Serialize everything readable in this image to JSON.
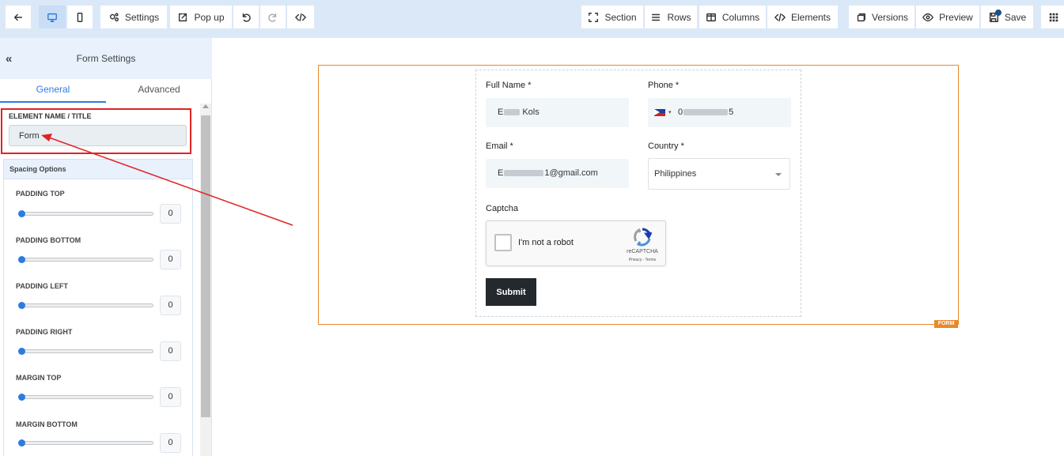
{
  "toolbar": {
    "settings_label": "Settings",
    "popup_label": "Pop up",
    "section_label": "Section",
    "rows_label": "Rows",
    "columns_label": "Columns",
    "elements_label": "Elements",
    "versions_label": "Versions",
    "preview_label": "Preview",
    "save_label": "Save"
  },
  "sidebar": {
    "title": "Form Settings",
    "tabs": [
      {
        "label": "General",
        "active": true
      },
      {
        "label": "Advanced",
        "active": false
      }
    ],
    "element_name_label": "ELEMENT NAME / TITLE",
    "element_name_value": "Form",
    "spacing_header": "Spacing Options",
    "spacing": [
      {
        "label": "PADDING TOP",
        "value": "0"
      },
      {
        "label": "PADDING BOTTOM",
        "value": "0"
      },
      {
        "label": "PADDING LEFT",
        "value": "0"
      },
      {
        "label": "PADDING RIGHT",
        "value": "0"
      },
      {
        "label": "MARGIN TOP",
        "value": "0"
      },
      {
        "label": "MARGIN BOTTOM",
        "value": "0"
      }
    ]
  },
  "canvas": {
    "form_tag": "FORM",
    "form": {
      "full_name_label": "Full Name *",
      "full_name_prefix": "E",
      "full_name_suffix": "Kols",
      "phone_label": "Phone *",
      "phone_prefix": "0",
      "phone_suffix": "5",
      "email_label": "Email *",
      "email_prefix": "E",
      "email_suffix": "1@gmail.com",
      "country_label": "Country *",
      "country_value": "Philippines",
      "captcha_label": "Captcha",
      "captcha_checkbox_label": "I'm not a robot",
      "recaptcha_brand": "reCAPTCHA",
      "recaptcha_links": "Privacy - Terms",
      "submit_label": "Submit"
    }
  },
  "colors": {
    "accent": "#2e7be0",
    "topbar_bg": "#dbe8f8",
    "highlight": "#e02424",
    "form_frame": "#e8892a",
    "submit_bg": "#24292e"
  }
}
